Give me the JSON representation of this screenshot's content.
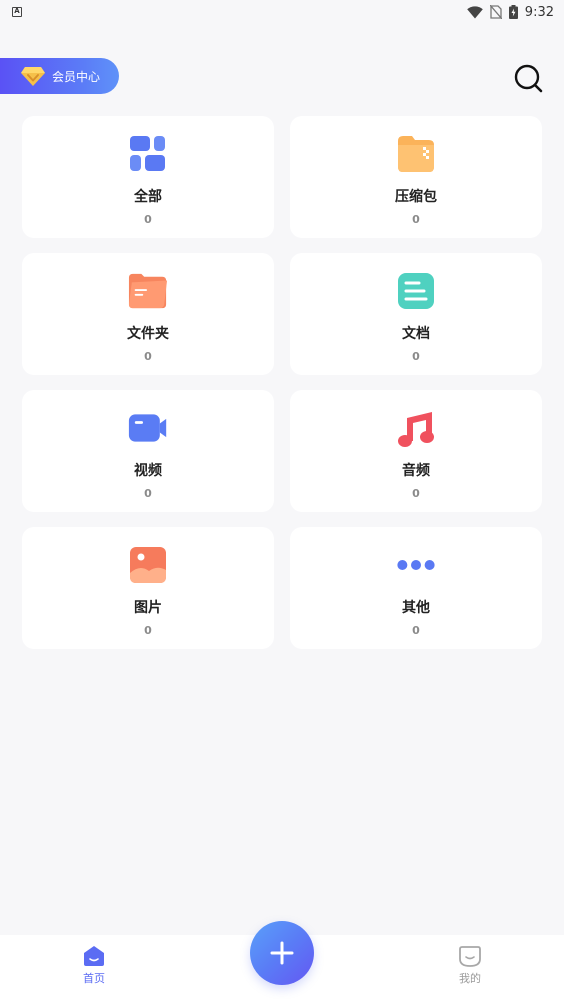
{
  "status_bar": {
    "time": "9:32",
    "left_icon": "A"
  },
  "header": {
    "vip_label": "会员中心"
  },
  "categories": [
    {
      "label": "全部",
      "count": "0",
      "icon": "grid-icon"
    },
    {
      "label": "压缩包",
      "count": "0",
      "icon": "zip-folder-icon"
    },
    {
      "label": "文件夹",
      "count": "0",
      "icon": "folder-icon"
    },
    {
      "label": "文档",
      "count": "0",
      "icon": "document-icon"
    },
    {
      "label": "视频",
      "count": "0",
      "icon": "video-icon"
    },
    {
      "label": "音频",
      "count": "0",
      "icon": "music-icon"
    },
    {
      "label": "图片",
      "count": "0",
      "icon": "image-icon"
    },
    {
      "label": "其他",
      "count": "0",
      "icon": "more-icon"
    }
  ],
  "tabbar": {
    "home_label": "首页",
    "mine_label": "我的"
  },
  "colors": {
    "accent": "#5b6cf3",
    "background": "#f7f7f9",
    "card": "#ffffff"
  }
}
